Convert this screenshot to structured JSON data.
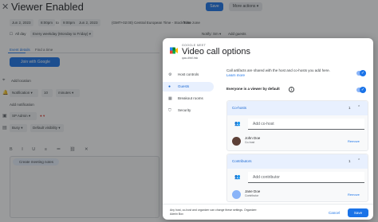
{
  "event": {
    "title": "Viewer Enabled",
    "save_label": "Save",
    "more_actions_label": "More actions ▾",
    "start_date": "Jun 2, 2023",
    "start_time": "8:00pm",
    "end_time": "9:00pm",
    "end_date": "Jun 2, 2023",
    "timezone": "(GMT+02:00) Central European Time - Stockholm",
    "timezone_link": "Time zone",
    "all_day_label": "All day",
    "recurrence": "Every weekday (Monday to Friday) ▾",
    "notify": "Notify: Sm ▾",
    "add_guests": "Add guests",
    "tabs": [
      "Event details",
      "Find a time"
    ],
    "join_button": "Join with Google Meet",
    "location_placeholder": "Add location",
    "notification_type": "Notification ▾",
    "notification_value": "10",
    "notification_unit": "minutes ▾",
    "add_notification": "Add notification",
    "calendar_owner": "SP Admin ▾",
    "busy_label": "Busy ▾",
    "visibility": "Default visibility ▾",
    "create_notes": "Create meeting notes"
  },
  "dialog": {
    "product": "GOOGLE MEET",
    "title": "Video call options",
    "meet_code": "qaa-dhkf-hsk",
    "nav": [
      {
        "label": "Host controls",
        "icon": "⚙"
      },
      {
        "label": "Guests",
        "icon": "👤"
      },
      {
        "label": "Breakout rooms",
        "icon": "▦"
      },
      {
        "label": "Security",
        "icon": "🔒"
      }
    ],
    "artifacts_text": "Call artifacts are shared with the host and co-hosts you add here.",
    "learn_more": "Learn more",
    "viewer_default": "Everyone is a viewer by default",
    "info_glyph": "i",
    "cohosts": {
      "title": "Co-hosts",
      "count": "1",
      "add_placeholder": "Add co-host",
      "people": [
        {
          "name": "John Doe",
          "role": "Co-host",
          "remove": "Remove"
        }
      ]
    },
    "contributors": {
      "title": "Contributors",
      "count": "1",
      "add_placeholder": "Add contributor",
      "people": [
        {
          "name": "Jane Doe",
          "role": "Contributor",
          "remove": "Remove"
        }
      ]
    },
    "footer_note": "Any host, co-host and organizer can change these settings. Organizer: Admin Box",
    "cancel": "Cancel",
    "save": "Save"
  },
  "colors": {
    "accent": "#1a73e8",
    "active_nav_bg": "#e8f0fe",
    "scrim": "rgba(32,33,36,0.45)"
  }
}
